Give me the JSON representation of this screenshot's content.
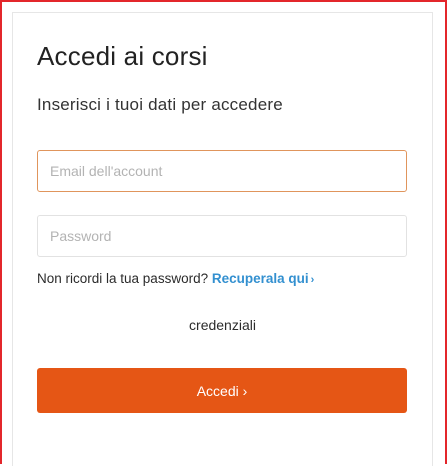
{
  "login": {
    "title": "Accedi ai corsi",
    "subtitle": "Inserisci i tuoi dati per accedere",
    "email_placeholder": "Email dell'account",
    "password_placeholder": "Password",
    "forgot_prompt": "Non ricordi la tua password?",
    "forgot_link": "Recuperala qui",
    "forgot_link_icon": "chevron-right",
    "credentials_text": "credenziali",
    "submit_label": "Accedi",
    "submit_icon": "chevron-right"
  },
  "colors": {
    "accent": "#e55615",
    "link": "#3390d0",
    "frame_border": "#e3262b",
    "focus_border": "#e0955c"
  }
}
